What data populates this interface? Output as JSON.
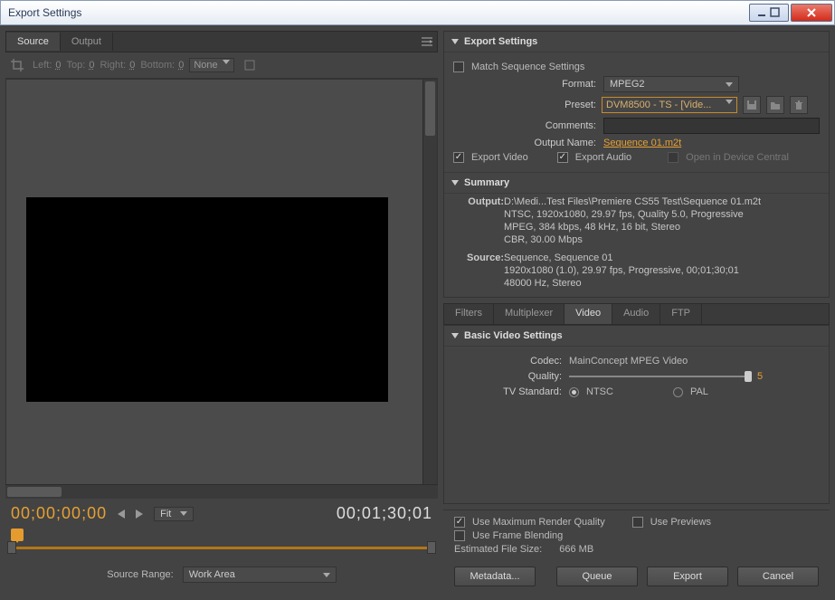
{
  "window": {
    "title": "Export Settings"
  },
  "left": {
    "tabs": {
      "source": "Source",
      "output": "Output"
    },
    "crop": {
      "left_lbl": "Left:",
      "left_val": "0",
      "top_lbl": "Top:",
      "top_val": "0",
      "right_lbl": "Right:",
      "right_val": "0",
      "bottom_lbl": "Bottom:",
      "bottom_val": "0",
      "scale": "None"
    },
    "tc_current": "00;00;00;00",
    "tc_duration": "00;01;30;01",
    "fit_label": "Fit",
    "source_range_lbl": "Source Range:",
    "source_range_val": "Work Area"
  },
  "export": {
    "heading": "Export Settings",
    "match_seq": "Match Sequence Settings",
    "format_lbl": "Format:",
    "format_val": "MPEG2",
    "preset_lbl": "Preset:",
    "preset_val": "DVM8500 - TS - [Vide...",
    "comments_lbl": "Comments:",
    "outputname_lbl": "Output Name:",
    "outputname_val": "Sequence 01.m2t",
    "export_video": "Export Video",
    "export_audio": "Export Audio",
    "open_device": "Open in Device Central",
    "summary_heading": "Summary",
    "out_lbl": "Output:",
    "out_val": "D:\\Medi...Test Files\\Premiere CS55 Test\\Sequence 01.m2t\nNTSC, 1920x1080, 29.97 fps, Quality 5.0, Progressive\nMPEG, 384 kbps, 48 kHz, 16 bit, Stereo\nCBR, 30.00 Mbps",
    "src_lbl": "Source:",
    "src_val": "Sequence, Sequence 01\n1920x1080 (1.0), 29.97 fps, Progressive, 00;01;30;01\n48000 Hz, Stereo"
  },
  "subtabs": {
    "filters": "Filters",
    "multiplexer": "Multiplexer",
    "video": "Video",
    "audio": "Audio",
    "ftp": "FTP"
  },
  "video": {
    "heading": "Basic Video Settings",
    "codec_lbl": "Codec:",
    "codec_val": "MainConcept MPEG Video",
    "quality_lbl": "Quality:",
    "quality_val": "5",
    "tvstd_lbl": "TV Standard:",
    "ntsc": "NTSC",
    "pal": "PAL"
  },
  "bottom": {
    "max_render": "Use Maximum Render Quality",
    "use_previews": "Use Previews",
    "frame_blend": "Use Frame Blending",
    "est_lbl": "Estimated File Size:",
    "est_val": "666 MB"
  },
  "buttons": {
    "metadata": "Metadata...",
    "queue": "Queue",
    "export": "Export",
    "cancel": "Cancel"
  }
}
